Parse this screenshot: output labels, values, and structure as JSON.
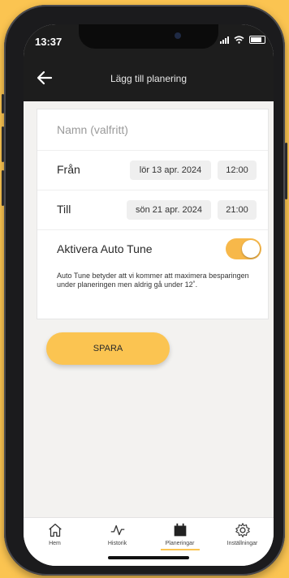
{
  "status_bar": {
    "time": "13:37"
  },
  "header": {
    "title": "Lägg till planering"
  },
  "form": {
    "name_placeholder": "Namn (valfritt)",
    "from": {
      "label": "Från",
      "date": "lör 13 apr. 2024",
      "time": "12:00"
    },
    "to": {
      "label": "Till",
      "date": "sön 21 apr. 2024",
      "time": "21:00"
    },
    "auto_tune": {
      "label": "Aktivera Auto Tune",
      "enabled": true,
      "description": "Auto Tune betyder att vi kommer att maximera besparingen under planeringen men aldrig gå under 12˚."
    }
  },
  "save_label": "SPARA",
  "tabs": [
    {
      "label": "Hem",
      "icon": "home-icon",
      "active": false
    },
    {
      "label": "Historik",
      "icon": "history-icon",
      "active": false
    },
    {
      "label": "Planeringar",
      "icon": "calendar-icon",
      "active": true
    },
    {
      "label": "Inställningar",
      "icon": "gear-icon",
      "active": false
    }
  ],
  "colors": {
    "accent": "#fbc451",
    "toggle": "#f7b84a",
    "topbar": "#1d1d1d"
  }
}
